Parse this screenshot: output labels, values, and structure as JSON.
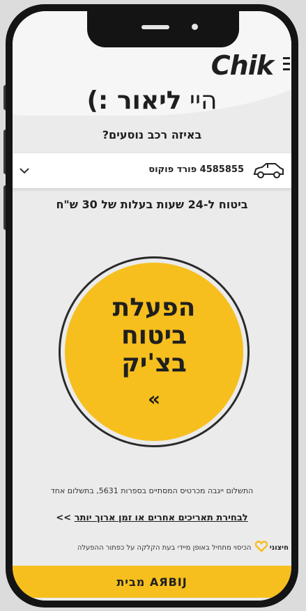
{
  "app": {
    "logo": "Chik",
    "logo_accent": "’"
  },
  "greeting": {
    "hey": "היי",
    "name": "ליאור :)"
  },
  "vehicle": {
    "question": "באיזה רכב נוסעים?",
    "plate_and_model": "4585855 פורד פוקוס",
    "icon": "car-icon",
    "dropdown_icon": "chevron-down-icon"
  },
  "coverage": {
    "text": "ביטוח ל-24 שעות בעלות של 30 ש\"ח"
  },
  "activate": {
    "line1": "הפעלת",
    "line2": "ביטוח",
    "line3": "בצ'יק",
    "arrows": "«"
  },
  "payment_note": "התשלום ייגבה מכרטיס המסתיים בספרות 5631, בתשלום אחד",
  "other_periods": {
    "link": "לבחירת תאריכים אחרים או זמן ארוך יותר",
    "arrows": ">>"
  },
  "disclaimer": {
    "brand": "חיצוני",
    "text": "הכיסוי מתחיל באופן מיידי בעת הקלקה על כפתור ההפעלה"
  },
  "bottom_button": {
    "label": "מבית AЯBIJ"
  },
  "colors": {
    "accent": "#f6bf1e",
    "text": "#1f1f1f",
    "background": "#ebebeb"
  }
}
